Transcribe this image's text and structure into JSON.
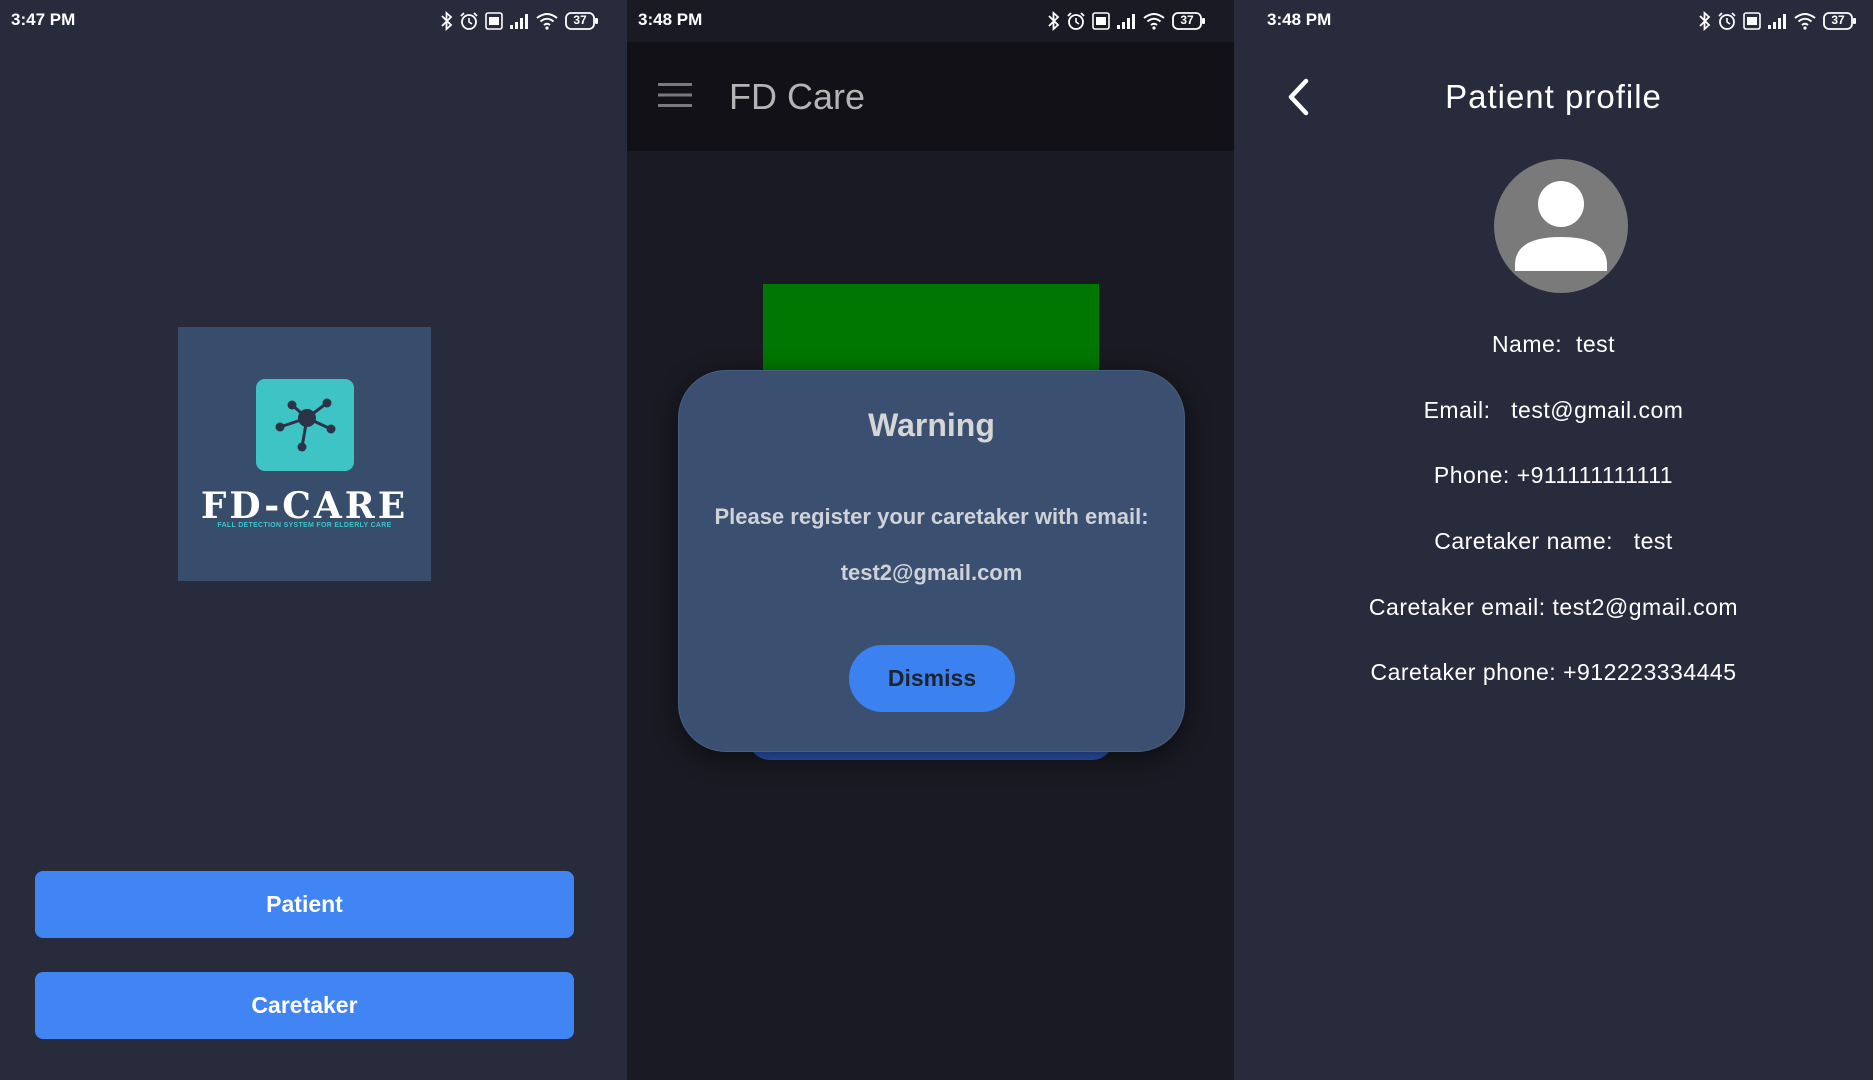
{
  "screen1": {
    "status_time": "3:47 PM",
    "battery": "37",
    "logo_title": "FD-CARE",
    "logo_subtitle": "FALL DETECTION SYSTEM FOR ELDERLY CARE",
    "patient_button": "Patient",
    "caretaker_button": "Caretaker"
  },
  "screen2": {
    "status_time": "3:48 PM",
    "battery": "37",
    "app_title": "FD Care",
    "dialog": {
      "title": "Warning",
      "message": "Please register your caretaker with email:",
      "email": "test2@gmail.com",
      "dismiss_label": "Dismiss"
    }
  },
  "screen3": {
    "status_time": "3:48 PM",
    "battery": "37",
    "page_title": "Patient profile",
    "name": "Name:  test",
    "email": "Email:   test@gmail.com",
    "phone": "Phone: +911111111111",
    "caretaker_name": "Caretaker name:   test",
    "caretaker_email": "Caretaker email: test2@gmail.com",
    "caretaker_phone": "Caretaker phone: +912223334445"
  },
  "colors": {
    "background_dark": "#282b3c",
    "dialog_background": "#3b5070",
    "button_blue": "#4184f3",
    "logo_teal": "#3fc4c6",
    "green_card": "#007700"
  },
  "icons": [
    "bluetooth-icon",
    "alarm-icon",
    "volte-icon",
    "signal-icon",
    "wifi-icon",
    "battery-icon",
    "menu-icon",
    "back-icon",
    "user-avatar-icon"
  ]
}
